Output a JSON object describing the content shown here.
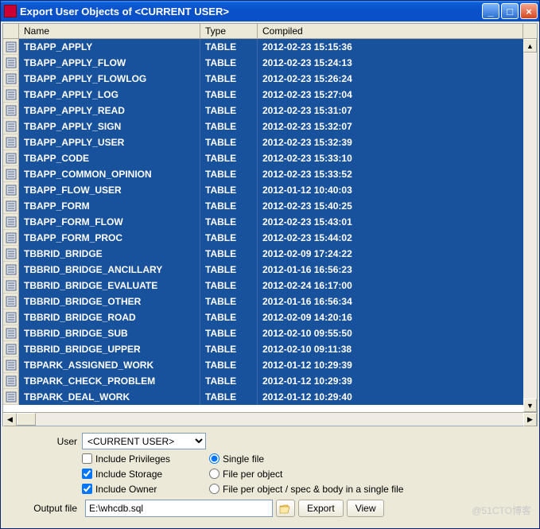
{
  "window": {
    "title": "Export User Objects of <CURRENT USER>"
  },
  "grid": {
    "headers": {
      "name": "Name",
      "type": "Type",
      "compiled": "Compiled"
    },
    "rows": [
      {
        "name": "TBAPP_APPLY",
        "type": "TABLE",
        "compiled": "2012-02-23 15:15:36"
      },
      {
        "name": "TBAPP_APPLY_FLOW",
        "type": "TABLE",
        "compiled": "2012-02-23 15:24:13"
      },
      {
        "name": "TBAPP_APPLY_FLOWLOG",
        "type": "TABLE",
        "compiled": "2012-02-23 15:26:24"
      },
      {
        "name": "TBAPP_APPLY_LOG",
        "type": "TABLE",
        "compiled": "2012-02-23 15:27:04"
      },
      {
        "name": "TBAPP_APPLY_READ",
        "type": "TABLE",
        "compiled": "2012-02-23 15:31:07"
      },
      {
        "name": "TBAPP_APPLY_SIGN",
        "type": "TABLE",
        "compiled": "2012-02-23 15:32:07"
      },
      {
        "name": "TBAPP_APPLY_USER",
        "type": "TABLE",
        "compiled": "2012-02-23 15:32:39"
      },
      {
        "name": "TBAPP_CODE",
        "type": "TABLE",
        "compiled": "2012-02-23 15:33:10"
      },
      {
        "name": "TBAPP_COMMON_OPINION",
        "type": "TABLE",
        "compiled": "2012-02-23 15:33:52"
      },
      {
        "name": "TBAPP_FLOW_USER",
        "type": "TABLE",
        "compiled": "2012-01-12 10:40:03"
      },
      {
        "name": "TBAPP_FORM",
        "type": "TABLE",
        "compiled": "2012-02-23 15:40:25"
      },
      {
        "name": "TBAPP_FORM_FLOW",
        "type": "TABLE",
        "compiled": "2012-02-23 15:43:01"
      },
      {
        "name": "TBAPP_FORM_PROC",
        "type": "TABLE",
        "compiled": "2012-02-23 15:44:02"
      },
      {
        "name": "TBBRID_BRIDGE",
        "type": "TABLE",
        "compiled": "2012-02-09 17:24:22"
      },
      {
        "name": "TBBRID_BRIDGE_ANCILLARY",
        "type": "TABLE",
        "compiled": "2012-01-16 16:56:23"
      },
      {
        "name": "TBBRID_BRIDGE_EVALUATE",
        "type": "TABLE",
        "compiled": "2012-02-24 16:17:00"
      },
      {
        "name": "TBBRID_BRIDGE_OTHER",
        "type": "TABLE",
        "compiled": "2012-01-16 16:56:34"
      },
      {
        "name": "TBBRID_BRIDGE_ROAD",
        "type": "TABLE",
        "compiled": "2012-02-09 14:20:16"
      },
      {
        "name": "TBBRID_BRIDGE_SUB",
        "type": "TABLE",
        "compiled": "2012-02-10 09:55:50"
      },
      {
        "name": "TBBRID_BRIDGE_UPPER",
        "type": "TABLE",
        "compiled": "2012-02-10 09:11:38"
      },
      {
        "name": "TBPARK_ASSIGNED_WORK",
        "type": "TABLE",
        "compiled": "2012-01-12 10:29:39"
      },
      {
        "name": "TBPARK_CHECK_PROBLEM",
        "type": "TABLE",
        "compiled": "2012-01-12 10:29:39"
      },
      {
        "name": "TBPARK_DEAL_WORK",
        "type": "TABLE",
        "compiled": "2012-01-12 10:29:40"
      }
    ]
  },
  "form": {
    "user_label": "User",
    "user_value": "<CURRENT USER>",
    "include_privileges": "Include Privileges",
    "include_storage": "Include Storage",
    "include_owner": "Include Owner",
    "single_file": "Single file",
    "file_per_object": "File per object",
    "file_per_object_spec": "File per object / spec & body in a single file",
    "output_file_label": "Output file",
    "output_file_value": "E:\\whcdb.sql",
    "export_btn": "Export",
    "view_btn": "View"
  },
  "watermark": "@51CTO博客"
}
